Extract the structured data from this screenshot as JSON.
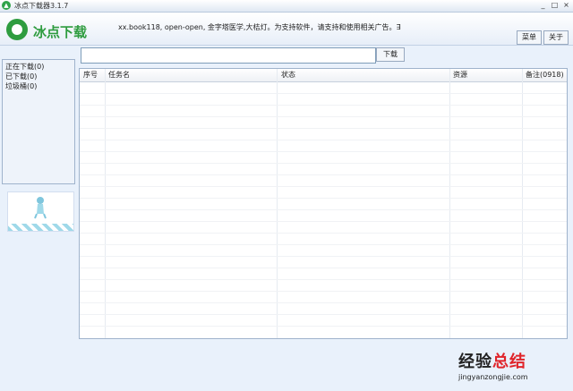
{
  "window": {
    "title": "冰点下载器3.1.7",
    "controls": [
      "_",
      "□",
      "×"
    ]
  },
  "header": {
    "logo_text": "冰点下载",
    "marquee": "xx.book118, open-open, 金字塔医学,大桔灯。为支持软件，请支持和使用相关广告。∃",
    "menu_label": "菜单",
    "about_label": "关于"
  },
  "sidebar": {
    "items": [
      {
        "label": "正在下载(0)"
      },
      {
        "label": "已下载(0)"
      },
      {
        "label": "垃圾桶(0)"
      }
    ]
  },
  "search": {
    "value": "",
    "download_label": "下载"
  },
  "table": {
    "columns": [
      "序号",
      "任务名",
      "状态",
      "资源",
      "备注(0918)"
    ],
    "rows": []
  },
  "watermark": {
    "main_a": "经验",
    "main_b": "总结",
    "sub": "jingyanzongjie.com"
  }
}
